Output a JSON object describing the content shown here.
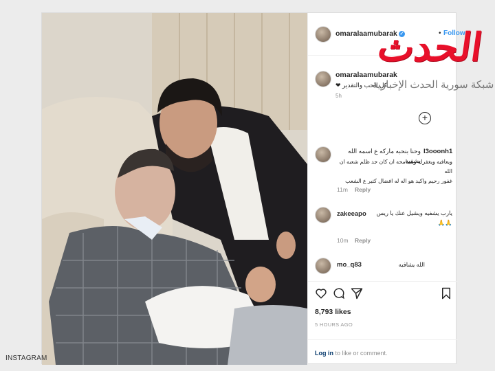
{
  "post": {
    "username": "omaralaamubarak",
    "follow_label": "Follow",
    "caption_username": "omaralaamubarak",
    "caption_text": "كل الحب والتقدير ❤",
    "caption_time": "5h"
  },
  "comments": [
    {
      "username": "l3ooonh1",
      "text_line1": "وحنا بنحبه ماركه ع اسمه الله يشفيه",
      "text_line2": "ويعافيه ويغفرله ويسامحه ان كان جد ظلم شعبه ان الله",
      "text_line3": "غفور رحيم واكيد هو اله له افضال كتير ع الشعب",
      "time": "11m",
      "reply": "Reply"
    },
    {
      "username": "zakeeapo",
      "text": "يارب يشفيه ويشيل عنك يا ريس 🙏🙏",
      "time": "10m",
      "reply": "Reply"
    },
    {
      "username": "mo_q83",
      "text": "الله يشافيه"
    }
  ],
  "actions": {
    "like_icon": "heart-icon",
    "comment_icon": "comment-icon",
    "share_icon": "share-icon",
    "save_icon": "bookmark-icon",
    "likes": "8,793 likes",
    "posted_ago": "5 HOURS AGO",
    "login_link": "Log in",
    "login_rest": " to like or comment."
  },
  "watermark": {
    "logo": "الحدث",
    "tagline": "شبكة سورية الحدث الإخبارية"
  },
  "credit": "INSTAGRAM",
  "colors": {
    "link_blue": "#3897f0",
    "watermark_red": "#e8102a",
    "dark_link": "#003569"
  }
}
